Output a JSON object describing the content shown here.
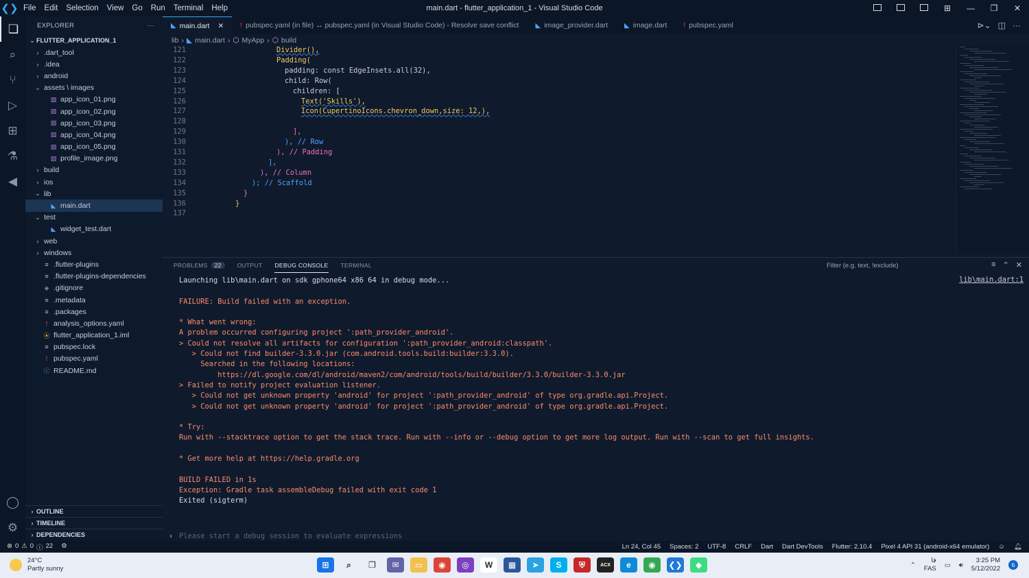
{
  "window": {
    "title": "main.dart - flutter_application_1 - Visual Studio Code",
    "menu": [
      "File",
      "Edit",
      "Selection",
      "View",
      "Go",
      "Run",
      "Terminal",
      "Help"
    ]
  },
  "sidebar": {
    "header": "EXPLORER",
    "root": "FLUTTER_APPLICATION_1",
    "items": [
      {
        "label": ".dart_tool",
        "type": "folder",
        "depth": 0,
        "open": false
      },
      {
        "label": ".idea",
        "type": "folder",
        "depth": 0,
        "open": false
      },
      {
        "label": "android",
        "type": "folder",
        "depth": 0,
        "open": false
      },
      {
        "label": "assets \\ images",
        "type": "folder",
        "depth": 0,
        "open": true
      },
      {
        "label": "app_icon_01.png",
        "type": "image",
        "depth": 1
      },
      {
        "label": "app_icon_02.png",
        "type": "image",
        "depth": 1
      },
      {
        "label": "app_icon_03.png",
        "type": "image",
        "depth": 1
      },
      {
        "label": "app_icon_04.png",
        "type": "image",
        "depth": 1
      },
      {
        "label": "app_icon_05.png",
        "type": "image",
        "depth": 1
      },
      {
        "label": "profile_image.png",
        "type": "image",
        "depth": 1
      },
      {
        "label": "build",
        "type": "folder",
        "depth": 0,
        "open": false
      },
      {
        "label": "ios",
        "type": "folder",
        "depth": 0,
        "open": false
      },
      {
        "label": "lib",
        "type": "folder",
        "depth": 0,
        "open": true
      },
      {
        "label": "main.dart",
        "type": "dart",
        "depth": 1,
        "selected": true
      },
      {
        "label": "test",
        "type": "folder",
        "depth": 0,
        "open": true
      },
      {
        "label": "widget_test.dart",
        "type": "dart",
        "depth": 1
      },
      {
        "label": "web",
        "type": "folder",
        "depth": 0,
        "open": false
      },
      {
        "label": "windows",
        "type": "folder",
        "depth": 0,
        "open": false
      },
      {
        "label": ".flutter-plugins",
        "type": "text",
        "depth": 0
      },
      {
        "label": ".flutter-plugins-dependencies",
        "type": "text",
        "depth": 0
      },
      {
        "label": ".gitignore",
        "type": "git",
        "depth": 0
      },
      {
        "label": ".metadata",
        "type": "text",
        "depth": 0
      },
      {
        "label": ".packages",
        "type": "text",
        "depth": 0
      },
      {
        "label": "analysis_options.yaml",
        "type": "yaml",
        "depth": 0
      },
      {
        "label": "flutter_application_1.iml",
        "type": "rss",
        "depth": 0
      },
      {
        "label": "pubspec.lock",
        "type": "text",
        "depth": 0
      },
      {
        "label": "pubspec.yaml",
        "type": "yaml",
        "depth": 0
      },
      {
        "label": "README.md",
        "type": "info",
        "depth": 0
      }
    ],
    "sections": [
      "OUTLINE",
      "TIMELINE",
      "DEPENDENCIES"
    ]
  },
  "tabs": [
    {
      "label": "main.dart",
      "icon": "dart",
      "active": true
    },
    {
      "label": "pubspec.yaml (in file) ↔ pubspec.yaml (in Visual Studio Code) - Resolve save conflict",
      "icon": "yaml",
      "active": false
    },
    {
      "label": "image_provider.dart",
      "icon": "dart",
      "active": false
    },
    {
      "label": "image.dart",
      "icon": "dart",
      "active": false
    },
    {
      "label": "pubspec.yaml",
      "icon": "yaml",
      "active": false
    }
  ],
  "breadcrumb": [
    "lib",
    "main.dart",
    "MyApp",
    "build"
  ],
  "editor": {
    "line_numbers": [
      "121",
      "122",
      "123",
      "124",
      "125",
      "126",
      "127",
      "128",
      "129",
      "130",
      "131",
      "132",
      "133",
      "134",
      "135",
      "136",
      "137"
    ],
    "lines": [
      "Divider(),",
      "Padding(",
      "padding: const EdgeInsets.all(32),",
      "child: Row(",
      "children: [",
      "Text('Skills'),",
      "Icon(CupertinoIcons.chevron_down,size: 12,),",
      "",
      "],",
      "), // Row",
      "), // Padding",
      "],",
      "), // Column",
      "); // Scaffold",
      "}",
      "}",
      ""
    ]
  },
  "panel": {
    "tabs": [
      "PROBLEMS",
      "OUTPUT",
      "DEBUG CONSOLE",
      "TERMINAL"
    ],
    "problems_count": "22",
    "filter_placeholder": "Filter (e.g. text, !exclude)",
    "source_link": "lib\\main.dart:1",
    "console": [
      {
        "text": "Launching lib\\main.dart on sdk gphone64 x86 64 in debug mode...",
        "kind": "ok"
      },
      {
        "text": "",
        "kind": "ok"
      },
      {
        "text": "FAILURE: Build failed with an exception.",
        "kind": "err"
      },
      {
        "text": "",
        "kind": "ok"
      },
      {
        "text": "* What went wrong:",
        "kind": "err"
      },
      {
        "text": "A problem occurred configuring project ':path_provider_android'.",
        "kind": "err"
      },
      {
        "text": "> Could not resolve all artifacts for configuration ':path_provider_android:classpath'.",
        "kind": "err"
      },
      {
        "text": "   > Could not find builder-3.3.0.jar (com.android.tools.build:builder:3.3.0).",
        "kind": "err"
      },
      {
        "text": "     Searched in the following locations:",
        "kind": "err"
      },
      {
        "text": "         https://dl.google.com/dl/android/maven2/com/android/tools/build/builder/3.3.0/builder-3.3.0.jar",
        "kind": "err"
      },
      {
        "text": "> Failed to notify project evaluation listener.",
        "kind": "err"
      },
      {
        "text": "   > Could not get unknown property 'android' for project ':path_provider_android' of type org.gradle.api.Project.",
        "kind": "err"
      },
      {
        "text": "   > Could not get unknown property 'android' for project ':path_provider_android' of type org.gradle.api.Project.",
        "kind": "err"
      },
      {
        "text": "",
        "kind": "ok"
      },
      {
        "text": "* Try:",
        "kind": "err"
      },
      {
        "text": "Run with --stacktrace option to get the stack trace. Run with --info or --debug option to get more log output. Run with --scan to get full insights.",
        "kind": "err"
      },
      {
        "text": "",
        "kind": "ok"
      },
      {
        "text": "* Get more help at https://help.gradle.org",
        "kind": "err"
      },
      {
        "text": "",
        "kind": "ok"
      },
      {
        "text": "BUILD FAILED in 1s",
        "kind": "err"
      },
      {
        "text": "Exception: Gradle task assembleDebug failed with exit code 1",
        "kind": "err"
      },
      {
        "text": "Exited (sigterm)",
        "kind": "ok"
      }
    ],
    "prompt_placeholder": "Please start a debug session to evaluate expressions"
  },
  "statusbar": {
    "errors": "0",
    "warnings": "0",
    "info": "22",
    "cursor": "Ln 24, Col 45",
    "spaces": "Spaces: 2",
    "encoding": "UTF-8",
    "eol": "CRLF",
    "language": "Dart",
    "devtools": "Dart DevTools",
    "flutter": "Flutter: 2.10.4",
    "device": "Pixel 4 API 31 (android-x64 emulator)"
  },
  "taskbar": {
    "temp": "24°C",
    "weather": "Partly sunny",
    "lang": "FAS",
    "lang_top": "فا",
    "time": "3:25 PM",
    "date": "5/12/2022",
    "notifications": "6",
    "apps": [
      {
        "name": "windows-icon",
        "bg": "#1a73e8",
        "glyph": "⊞"
      },
      {
        "name": "search-icon",
        "bg": "transparent",
        "glyph": "⌕"
      },
      {
        "name": "task-view-icon",
        "bg": "transparent",
        "glyph": "❐"
      },
      {
        "name": "chat-icon",
        "bg": "#6264a7",
        "glyph": "✉"
      },
      {
        "name": "file-explorer-icon",
        "bg": "#f2c04d",
        "glyph": "▭"
      },
      {
        "name": "chrome-icon",
        "bg": "#db4437",
        "glyph": "◉"
      },
      {
        "name": "podcast-icon",
        "bg": "#7b3fbf",
        "glyph": "◎"
      },
      {
        "name": "word-icon",
        "bg": "#ffffff",
        "glyph": "W"
      },
      {
        "name": "store-icon",
        "bg": "#2b579a",
        "glyph": "▦"
      },
      {
        "name": "telegram-icon",
        "bg": "#2aa3e0",
        "glyph": "➤"
      },
      {
        "name": "skype-icon",
        "bg": "#00aff0",
        "glyph": "S"
      },
      {
        "name": "security-icon",
        "bg": "#c62828",
        "glyph": "⛨"
      },
      {
        "name": "terminal-app-icon",
        "bg": "#222222",
        "glyph": "ACX"
      },
      {
        "name": "edge-icon",
        "bg": "#0f8ad6",
        "glyph": "e"
      },
      {
        "name": "chrome-2-icon",
        "bg": "#34a853",
        "glyph": "◉"
      },
      {
        "name": "vscode-icon",
        "bg": "#1f7ad8",
        "glyph": "❮❯"
      },
      {
        "name": "android-studio-icon",
        "bg": "#3ddc84",
        "glyph": "◆"
      }
    ]
  },
  "colors": {
    "accent": "#3ba5f0",
    "error_text": "#ff8a6a",
    "editor_bg": "#0f1b2d"
  }
}
